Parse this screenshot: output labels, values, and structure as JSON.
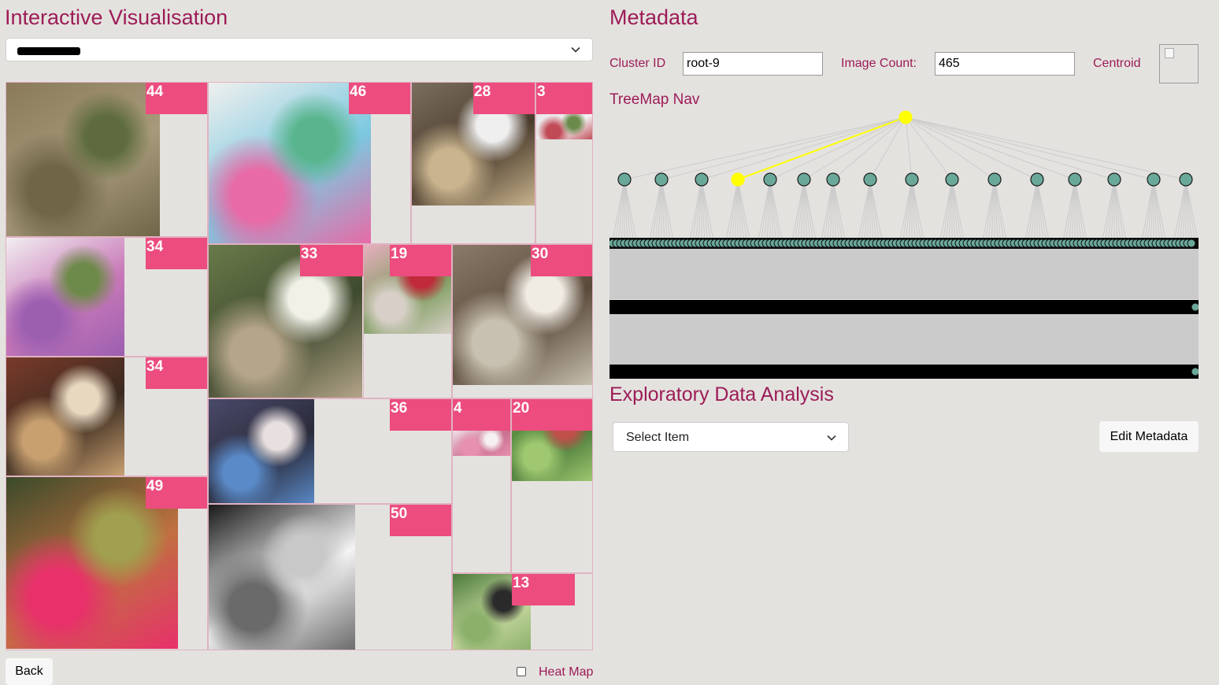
{
  "left_panel": {
    "title": "Interactive Visualisation",
    "dataset_select": {
      "value": ""
    },
    "tiles": [
      {
        "count": "44",
        "palette": [
          "#8a7a5a",
          "#6f6648",
          "#5d6b3e",
          "#a79a7a"
        ]
      },
      {
        "count": "46",
        "palette": [
          "#f0f0ee",
          "#e86aa6",
          "#59b58d",
          "#7cc8e0"
        ]
      },
      {
        "count": "28",
        "palette": [
          "#7a6e5e",
          "#c9b48e",
          "#efefef",
          "#4a3b2c"
        ]
      },
      {
        "count": "3",
        "palette": [
          "#e9e6ea",
          "#c04a55",
          "#6a8a4a",
          "#f2f2f2"
        ]
      },
      {
        "count": "34",
        "palette": [
          "#f2eef0",
          "#9c5fb0",
          "#6e8a4a",
          "#c878b8"
        ]
      },
      {
        "count": "33",
        "palette": [
          "#6a7a4a",
          "#b5a58a",
          "#f1f1e8",
          "#3f4a2e"
        ]
      },
      {
        "count": "19",
        "palette": [
          "#e8b0c0",
          "#d8d0c8",
          "#c02a3a",
          "#7a9a5a"
        ]
      },
      {
        "count": "30",
        "palette": [
          "#8a7a6a",
          "#c8c0b0",
          "#f0ece4",
          "#5a4a3a"
        ]
      },
      {
        "count": "34",
        "palette": [
          "#7a3a2a",
          "#c8a070",
          "#e8d8c0",
          "#3a2a20"
        ]
      },
      {
        "count": "36",
        "palette": [
          "#4a4a6a",
          "#5a8ac8",
          "#e8e0e0",
          "#2a2a3a"
        ]
      },
      {
        "count": "4",
        "palette": [
          "#f0e0e8",
          "#e890b0",
          "#f6f0f2",
          "#c87090"
        ]
      },
      {
        "count": "20",
        "palette": [
          "#6aa04a",
          "#a0c870",
          "#c0504a",
          "#4a7a3a"
        ]
      },
      {
        "count": "49",
        "palette": [
          "#3a4a2a",
          "#e8306a",
          "#a0a050",
          "#c07040"
        ]
      },
      {
        "count": "50",
        "palette": [
          "#1a1a1a",
          "#6a6a6a",
          "#c8c8c8",
          "#f4f4f4"
        ]
      },
      {
        "count": "13",
        "palette": [
          "#4a7a3a",
          "#8ab06a",
          "#2a2a2a",
          "#c8d8a0"
        ]
      }
    ],
    "back_button": "Back",
    "heatmap": {
      "label": "Heat Map",
      "checked": false
    }
  },
  "metadata": {
    "title": "Metadata",
    "cluster_id_label": "Cluster ID",
    "cluster_id_value": "root-9",
    "image_count_label": "Image Count:",
    "image_count_value": "465",
    "centroid_label": "Centroid",
    "treemap_nav_label": "TreeMap Nav",
    "tree": {
      "children": 15,
      "selected_child_index": 3,
      "node_color": "#6aa89a",
      "highlight_color": "#ffff00"
    }
  },
  "eda": {
    "title": "Exploratory Data Analysis",
    "select_placeholder": "Select Item",
    "edit_button": "Edit Metadata"
  }
}
